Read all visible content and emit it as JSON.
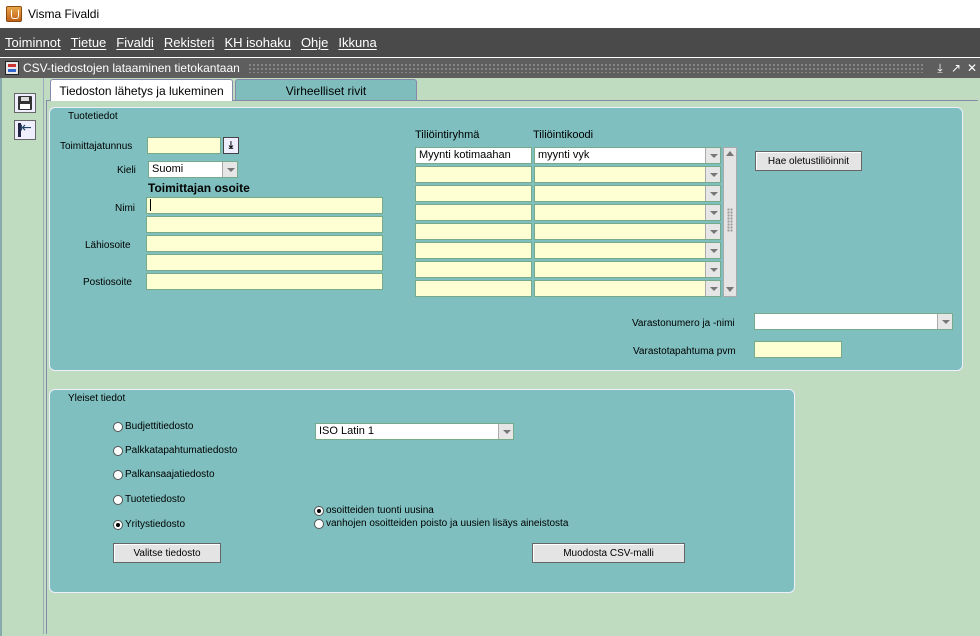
{
  "app": {
    "title": "Visma Fivaldi"
  },
  "menu": [
    "Toiminnot",
    "Tietue",
    "Fivaldi",
    "Rekisteri",
    "KH isohaku",
    "Ohje",
    "Ikkuna"
  ],
  "window": {
    "title": "CSV-tiedostojen lataaminen tietokantaan",
    "controls": [
      "⤓",
      "↗",
      "✕"
    ]
  },
  "tabs": [
    {
      "label": "Tiedoston lähetys ja lukeminen",
      "active": true
    },
    {
      "label": "Virheelliset rivit",
      "active": false
    }
  ],
  "tuotetiedot": {
    "group_label": "Tuotetiedot",
    "toimittajatunnus_label": "Toimittajatunnus",
    "toimittajatunnus_value": "",
    "kieli_label": "Kieli",
    "kieli_value": "Suomi",
    "osoite_header": "Toimittajan osoite",
    "nimi_label": "Nimi",
    "lahiosoite_label": "Lähiosoite",
    "postiosoite_label": "Postiosoite",
    "tiliointiryhma_header": "Tiliöintiryhmä",
    "tiliointikoodi_header": "Tiliöintikoodi",
    "rows": [
      {
        "ryhma": "Myynti kotimaahan",
        "koodi": "myynti vyk"
      },
      {
        "ryhma": "",
        "koodi": ""
      },
      {
        "ryhma": "",
        "koodi": ""
      },
      {
        "ryhma": "",
        "koodi": ""
      },
      {
        "ryhma": "",
        "koodi": ""
      },
      {
        "ryhma": "",
        "koodi": ""
      },
      {
        "ryhma": "",
        "koodi": ""
      },
      {
        "ryhma": "",
        "koodi": ""
      }
    ],
    "hae_button": "Hae oletustiliöinnit",
    "varasto_label": "Varastonumero ja -nimi",
    "varasto_value": "",
    "varastotapahtuma_label": "Varastotapahtuma pvm",
    "varastotapahtuma_value": ""
  },
  "yleiset": {
    "group_label": "Yleiset tiedot",
    "file_types": [
      {
        "label": "Budjettitiedosto",
        "checked": false
      },
      {
        "label": "Palkkatapahtumatiedosto",
        "checked": false
      },
      {
        "label": "Palkansaajatiedosto",
        "checked": false
      },
      {
        "label": "Tuotetiedosto",
        "checked": false
      },
      {
        "label": "Yritystiedosto",
        "checked": true
      }
    ],
    "encoding_value": "ISO Latin 1",
    "address_options": [
      {
        "label": "osoitteiden tuonti uusina",
        "checked": true
      },
      {
        "label": "vanhojen osoitteiden poisto ja uusien lisäys aineistosta",
        "checked": false
      }
    ],
    "valitse_button": "Valitse tiedosto",
    "muodosta_button": "Muodosta CSV-malli"
  }
}
